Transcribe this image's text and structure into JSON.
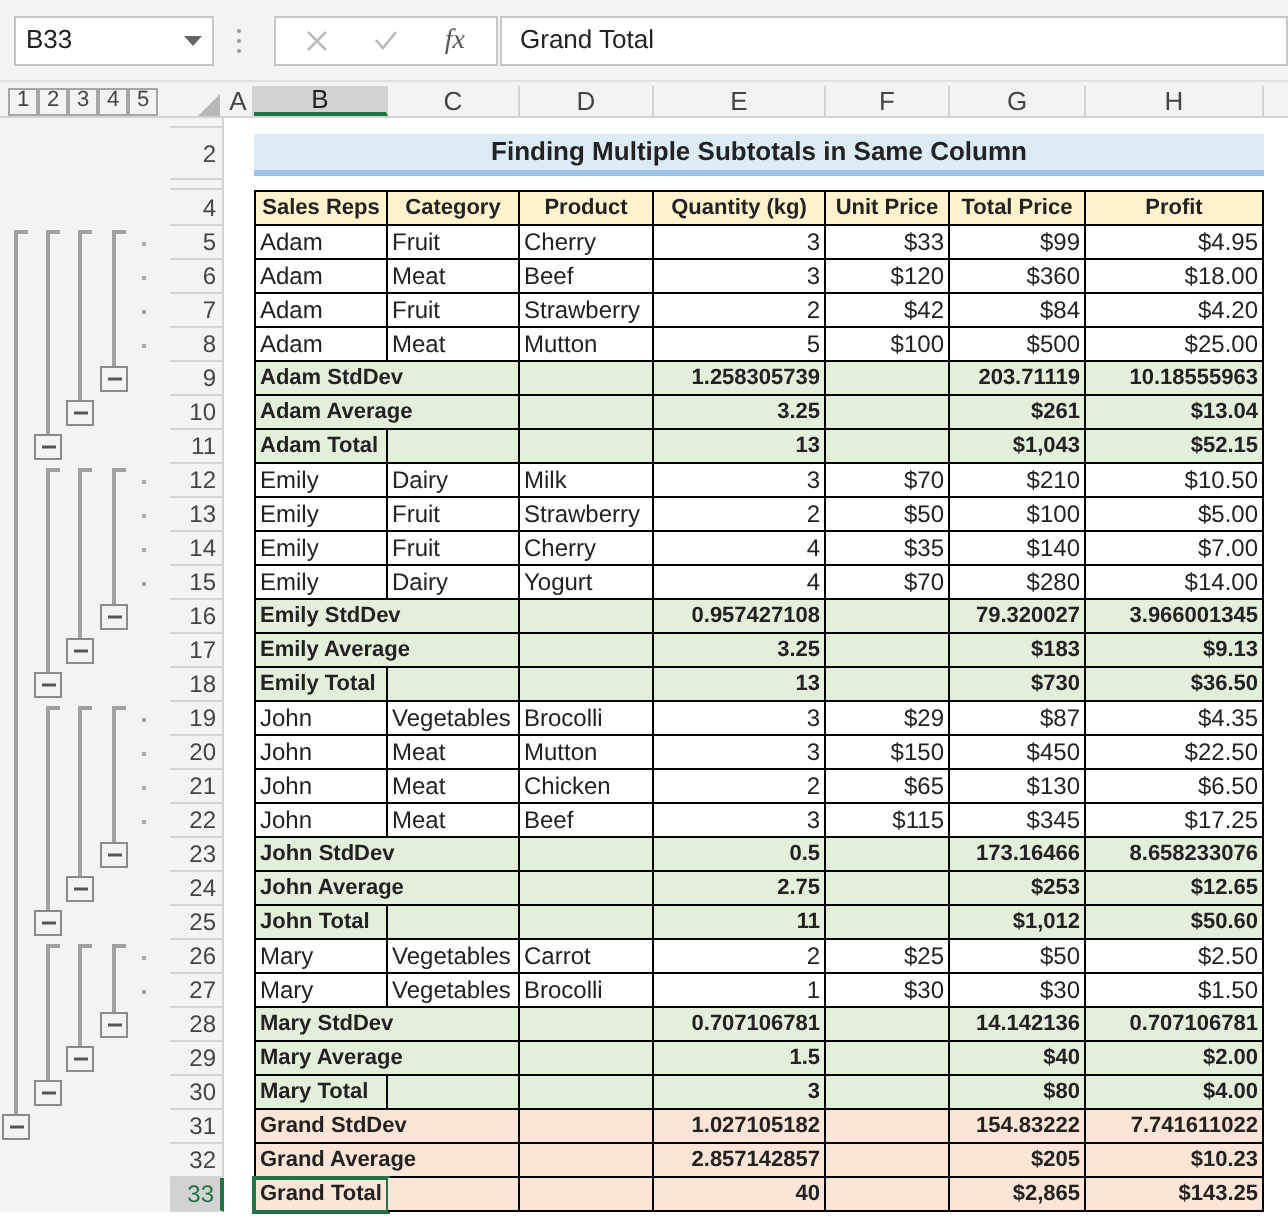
{
  "name_box": "B33",
  "fx_label": "fx",
  "formula": "Grand Total",
  "outline_levels": [
    "1",
    "2",
    "3",
    "4",
    "5"
  ],
  "columns": [
    {
      "label": "A",
      "selected": false
    },
    {
      "label": "B",
      "selected": true
    },
    {
      "label": "C",
      "selected": false
    },
    {
      "label": "D",
      "selected": false
    },
    {
      "label": "E",
      "selected": false
    },
    {
      "label": "F",
      "selected": false
    },
    {
      "label": "G",
      "selected": false
    },
    {
      "label": "H",
      "selected": false
    }
  ],
  "rows": [
    {
      "kind": "spacer",
      "selected": false
    },
    {
      "label": "2",
      "kind": "title",
      "selected": false,
      "text": "Finding Multiple Subtotals in Same Column"
    },
    {
      "kind": "spacer",
      "selected": false
    },
    {
      "label": "4",
      "kind": "header",
      "selected": false,
      "cells": [
        "Sales Reps",
        "Category",
        "Product",
        "Quantity (kg)",
        "Unit Price",
        "Total Price",
        "Profit"
      ]
    },
    {
      "label": "5",
      "kind": "data",
      "selected": false,
      "cells": [
        "Adam",
        "Fruit",
        "Cherry",
        "3",
        {
          "currency": "$",
          "amount": "33"
        },
        {
          "currency": "$",
          "amount": "99"
        },
        {
          "currency": "$",
          "amount": "4.95"
        }
      ]
    },
    {
      "label": "6",
      "kind": "data",
      "selected": false,
      "cells": [
        "Adam",
        "Meat",
        "Beef",
        "3",
        {
          "currency": "$",
          "amount": "120"
        },
        {
          "currency": "$",
          "amount": "360"
        },
        {
          "currency": "$",
          "amount": "18.00"
        }
      ]
    },
    {
      "label": "7",
      "kind": "data",
      "selected": false,
      "cells": [
        "Adam",
        "Fruit",
        "Strawberry",
        "2",
        {
          "currency": "$",
          "amount": "42"
        },
        {
          "currency": "$",
          "amount": "84"
        },
        {
          "currency": "$",
          "amount": "4.20"
        }
      ]
    },
    {
      "label": "8",
      "kind": "data",
      "selected": false,
      "cells": [
        "Adam",
        "Meat",
        "Mutton",
        "5",
        {
          "currency": "$",
          "amount": "100"
        },
        {
          "currency": "$",
          "amount": "500"
        },
        {
          "currency": "$",
          "amount": "25.00"
        }
      ]
    },
    {
      "label": "9",
      "kind": "stddev",
      "selected": false,
      "cells": [
        "Adam StdDev",
        null,
        null,
        "1.258305739",
        null,
        "203.71119",
        "10.18555963"
      ]
    },
    {
      "label": "10",
      "kind": "average",
      "selected": false,
      "cells": [
        "Adam Average",
        null,
        null,
        "3.25",
        null,
        {
          "currency": "$",
          "amount": "261"
        },
        {
          "currency": "$",
          "amount": "13.04"
        }
      ]
    },
    {
      "label": "11",
      "kind": "total",
      "selected": false,
      "cells": [
        "Adam Total",
        null,
        null,
        "13",
        null,
        {
          "currency": "$",
          "amount": "1,043"
        },
        {
          "currency": "$",
          "amount": "52.15"
        }
      ]
    },
    {
      "label": "12",
      "kind": "data",
      "selected": false,
      "cells": [
        "Emily",
        "Dairy",
        "Milk",
        "3",
        {
          "currency": "$",
          "amount": "70"
        },
        {
          "currency": "$",
          "amount": "210"
        },
        {
          "currency": "$",
          "amount": "10.50"
        }
      ]
    },
    {
      "label": "13",
      "kind": "data",
      "selected": false,
      "cells": [
        "Emily",
        "Fruit",
        "Strawberry",
        "2",
        {
          "currency": "$",
          "amount": "50"
        },
        {
          "currency": "$",
          "amount": "100"
        },
        {
          "currency": "$",
          "amount": "5.00"
        }
      ]
    },
    {
      "label": "14",
      "kind": "data",
      "selected": false,
      "cells": [
        "Emily",
        "Fruit",
        "Cherry",
        "4",
        {
          "currency": "$",
          "amount": "35"
        },
        {
          "currency": "$",
          "amount": "140"
        },
        {
          "currency": "$",
          "amount": "7.00"
        }
      ]
    },
    {
      "label": "15",
      "kind": "data",
      "selected": false,
      "cells": [
        "Emily",
        "Dairy",
        "Yogurt",
        "4",
        {
          "currency": "$",
          "amount": "70"
        },
        {
          "currency": "$",
          "amount": "280"
        },
        {
          "currency": "$",
          "amount": "14.00"
        }
      ]
    },
    {
      "label": "16",
      "kind": "stddev",
      "selected": false,
      "cells": [
        "Emily StdDev",
        null,
        null,
        "0.957427108",
        null,
        "79.320027",
        "3.966001345"
      ]
    },
    {
      "label": "17",
      "kind": "average",
      "selected": false,
      "cells": [
        "Emily Average",
        null,
        null,
        "3.25",
        null,
        {
          "currency": "$",
          "amount": "183"
        },
        {
          "currency": "$",
          "amount": "9.13"
        }
      ]
    },
    {
      "label": "18",
      "kind": "total",
      "selected": false,
      "cells": [
        "Emily Total",
        null,
        null,
        "13",
        null,
        {
          "currency": "$",
          "amount": "730"
        },
        {
          "currency": "$",
          "amount": "36.50"
        }
      ]
    },
    {
      "label": "19",
      "kind": "data",
      "selected": false,
      "cells": [
        "John",
        "Vegetables",
        "Brocolli",
        "3",
        {
          "currency": "$",
          "amount": "29"
        },
        {
          "currency": "$",
          "amount": "87"
        },
        {
          "currency": "$",
          "amount": "4.35"
        }
      ]
    },
    {
      "label": "20",
      "kind": "data",
      "selected": false,
      "cells": [
        "John",
        "Meat",
        "Mutton",
        "3",
        {
          "currency": "$",
          "amount": "150"
        },
        {
          "currency": "$",
          "amount": "450"
        },
        {
          "currency": "$",
          "amount": "22.50"
        }
      ]
    },
    {
      "label": "21",
      "kind": "data",
      "selected": false,
      "cells": [
        "John",
        "Meat",
        "Chicken",
        "2",
        {
          "currency": "$",
          "amount": "65"
        },
        {
          "currency": "$",
          "amount": "130"
        },
        {
          "currency": "$",
          "amount": "6.50"
        }
      ]
    },
    {
      "label": "22",
      "kind": "data",
      "selected": false,
      "cells": [
        "John",
        "Meat",
        "Beef",
        "3",
        {
          "currency": "$",
          "amount": "115"
        },
        {
          "currency": "$",
          "amount": "345"
        },
        {
          "currency": "$",
          "amount": "17.25"
        }
      ]
    },
    {
      "label": "23",
      "kind": "stddev",
      "selected": false,
      "cells": [
        "John StdDev",
        null,
        null,
        "0.5",
        null,
        "173.16466",
        "8.658233076"
      ]
    },
    {
      "label": "24",
      "kind": "average",
      "selected": false,
      "cells": [
        "John Average",
        null,
        null,
        "2.75",
        null,
        {
          "currency": "$",
          "amount": "253"
        },
        {
          "currency": "$",
          "amount": "12.65"
        }
      ]
    },
    {
      "label": "25",
      "kind": "total",
      "selected": false,
      "cells": [
        "John Total",
        null,
        null,
        "11",
        null,
        {
          "currency": "$",
          "amount": "1,012"
        },
        {
          "currency": "$",
          "amount": "50.60"
        }
      ]
    },
    {
      "label": "26",
      "kind": "data",
      "selected": false,
      "cells": [
        "Mary",
        "Vegetables",
        "Carrot",
        "2",
        {
          "currency": "$",
          "amount": "25"
        },
        {
          "currency": "$",
          "amount": "50"
        },
        {
          "currency": "$",
          "amount": "2.50"
        }
      ]
    },
    {
      "label": "27",
      "kind": "data",
      "selected": false,
      "cells": [
        "Mary",
        "Vegetables",
        "Brocolli",
        "1",
        {
          "currency": "$",
          "amount": "30"
        },
        {
          "currency": "$",
          "amount": "30"
        },
        {
          "currency": "$",
          "amount": "1.50"
        }
      ]
    },
    {
      "label": "28",
      "kind": "stddev",
      "selected": false,
      "cells": [
        "Mary StdDev",
        null,
        null,
        "0.707106781",
        null,
        "14.142136",
        "0.707106781"
      ]
    },
    {
      "label": "29",
      "kind": "average",
      "selected": false,
      "cells": [
        "Mary Average",
        null,
        null,
        "1.5",
        null,
        {
          "currency": "$",
          "amount": "40"
        },
        {
          "currency": "$",
          "amount": "2.00"
        }
      ]
    },
    {
      "label": "30",
      "kind": "total",
      "selected": false,
      "cells": [
        "Mary Total",
        null,
        null,
        "3",
        null,
        {
          "currency": "$",
          "amount": "80"
        },
        {
          "currency": "$",
          "amount": "4.00"
        }
      ]
    },
    {
      "label": "31",
      "kind": "grand_stddev",
      "selected": false,
      "cells": [
        "Grand StdDev",
        null,
        null,
        "1.027105182",
        null,
        "154.83222",
        "7.741611022"
      ]
    },
    {
      "label": "32",
      "kind": "grand_average",
      "selected": false,
      "cells": [
        "Grand Average",
        null,
        null,
        "2.857142857",
        null,
        {
          "currency": "$",
          "amount": "205"
        },
        {
          "currency": "$",
          "amount": "10.23"
        }
      ]
    },
    {
      "label": "33",
      "kind": "grand_total",
      "selected": true,
      "cells": [
        "Grand Total",
        null,
        null,
        "40",
        null,
        {
          "currency": "$",
          "amount": "2,865"
        },
        {
          "currency": "$",
          "amount": "143.25"
        }
      ]
    }
  ]
}
